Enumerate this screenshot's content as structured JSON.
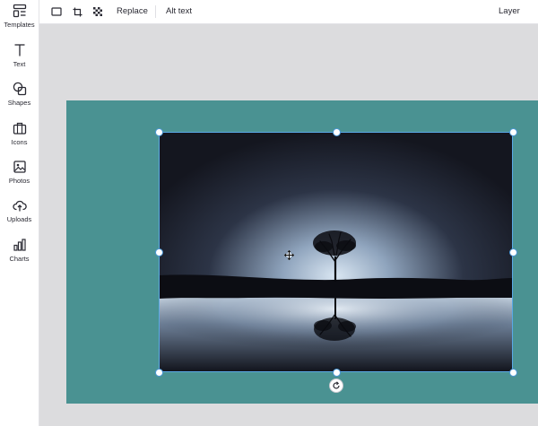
{
  "sidebar": {
    "items": [
      {
        "label": "Templates",
        "icon": "templates-icon"
      },
      {
        "label": "Text",
        "icon": "text-icon"
      },
      {
        "label": "Shapes",
        "icon": "shapes-icon"
      },
      {
        "label": "Icons",
        "icon": "briefcase-icon"
      },
      {
        "label": "Photos",
        "icon": "image-icon"
      },
      {
        "label": "Uploads",
        "icon": "cloud-upload-icon"
      },
      {
        "label": "Charts",
        "icon": "bar-chart-icon"
      }
    ]
  },
  "toolbar": {
    "replace_label": "Replace",
    "alt_text_label": "Alt text",
    "layer_label": "Layer"
  },
  "colors": {
    "page_background": "#4a9292",
    "workspace": "#dcdcde",
    "selection": "#5aa9e6"
  }
}
